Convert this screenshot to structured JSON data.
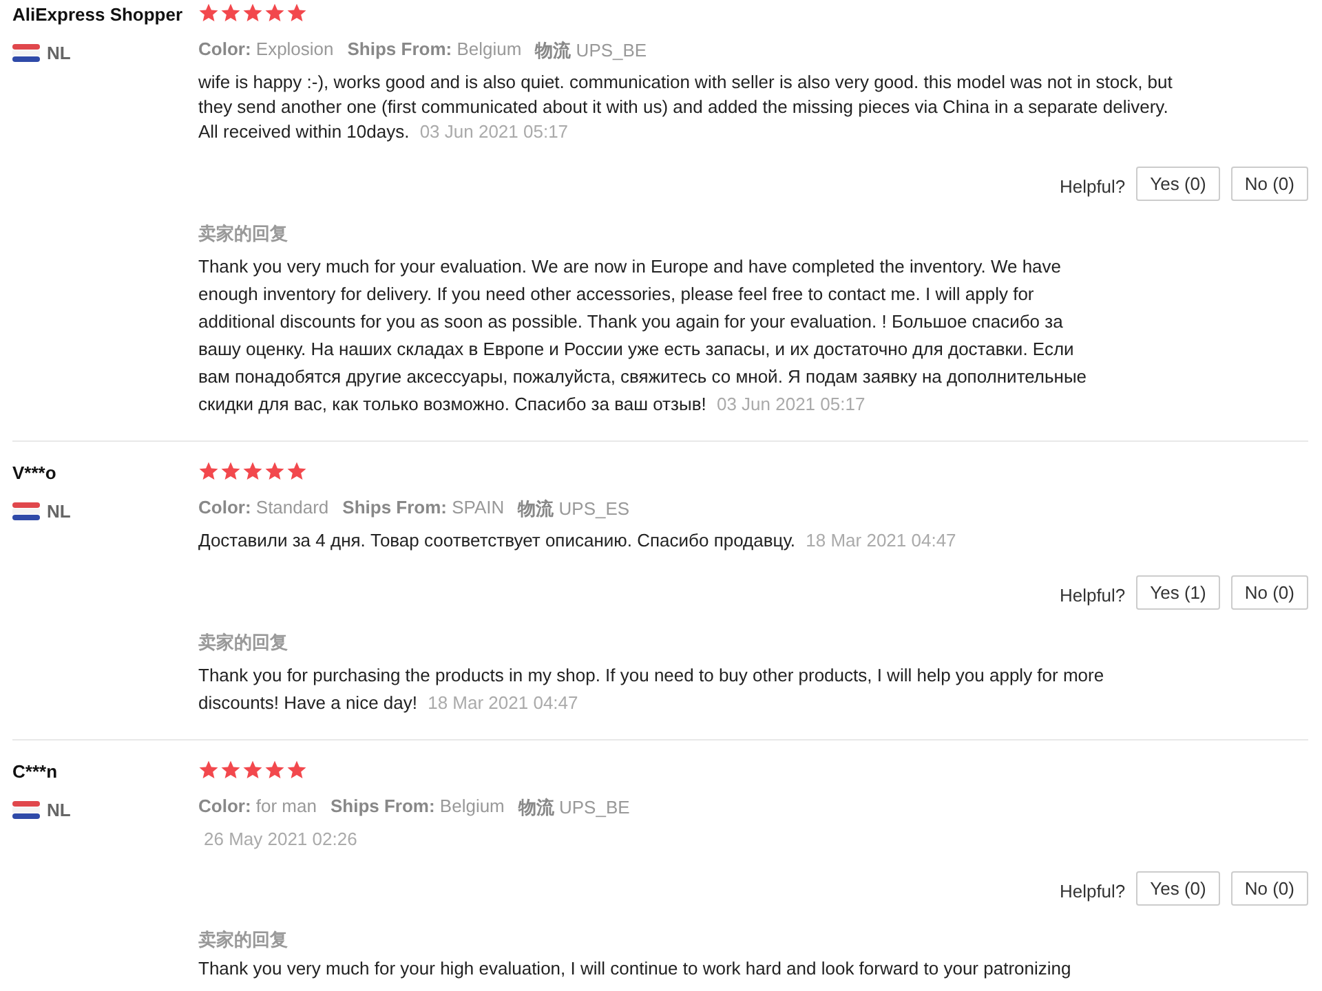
{
  "reviews": [
    {
      "name": "AliExpress Shopper",
      "country": "NL",
      "stars": 5,
      "attributes": [
        {
          "label": "Color:",
          "value": "Explosion"
        },
        {
          "label": "Ships From:",
          "value": "Belgium"
        },
        {
          "label": "物流",
          "value": "UPS_BE"
        }
      ],
      "text": "wife is happy :-), works good and is also quiet. communication with seller is also very good. this model was not in stock, but they send another one (first communicated about it with us) and added the missing pieces via China in a separate delivery. All received within 10days.",
      "date": "03 Jun 2021 05:17",
      "helpful_label": "Helpful?",
      "yes": "Yes (0)",
      "no": "No (0)",
      "reply_label": "卖家的回复",
      "reply": "Thank you very much for your evaluation. We are now in Europe and have completed the inventory. We have enough inventory for delivery. If you need other accessories, please feel free to contact me. I will apply for additional discounts for you as soon as possible. Thank you again for your evaluation. ! Большое спасибо за вашу оценку. На наших складах в Европе и России уже есть запасы, и их достаточно для доставки. Если вам понадобятся другие аксессуары, пожалуйста, свяжитесь со мной. Я подам заявку на дополнительные скидки для вас, как только возможно. Спасибо за ваш отзыв!",
      "reply_date": "03 Jun 2021 05:17"
    },
    {
      "name": "V***o",
      "country": "NL",
      "stars": 5,
      "attributes": [
        {
          "label": "Color:",
          "value": "Standard"
        },
        {
          "label": "Ships From:",
          "value": "SPAIN"
        },
        {
          "label": "物流",
          "value": "UPS_ES"
        }
      ],
      "text": "Доставили за 4 дня. Товар соответствует описанию. Спасибо продавцу.",
      "date": "18 Mar 2021 04:47",
      "helpful_label": "Helpful?",
      "yes": "Yes (1)",
      "no": "No (0)",
      "reply_label": "卖家的回复",
      "reply": "Thank you for purchasing the products in my shop. If you need to buy other products, I will help you apply for more discounts! Have a nice day!",
      "reply_date": "18 Mar 2021 04:47"
    },
    {
      "name": "C***n",
      "country": "NL",
      "stars": 5,
      "attributes": [
        {
          "label": "Color:",
          "value": "for man"
        },
        {
          "label": "Ships From:",
          "value": "Belgium"
        },
        {
          "label": "物流",
          "value": "UPS_BE"
        }
      ],
      "date": "26 May 2021 02:26",
      "helpful_label": "Helpful?",
      "yes": "Yes (0)",
      "no": "No (0)",
      "reply_label": "卖家的回复",
      "reply": "Thank you very much for your high evaluation, I will continue to work hard and look forward to your patronizing"
    }
  ]
}
